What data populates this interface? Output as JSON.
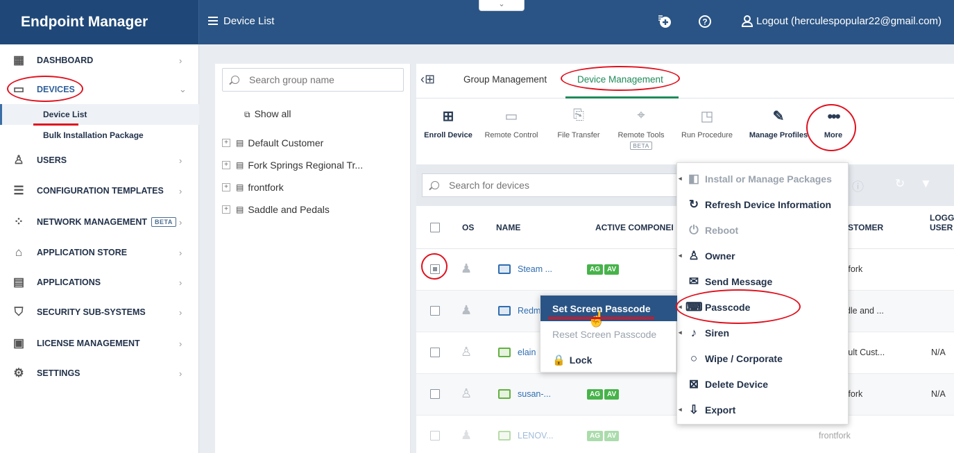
{
  "header": {
    "brand": "Endpoint Manager",
    "page_title": "Device List",
    "logout_label": "Logout (herculespopular22@gmail.com)",
    "collapse_glyph": "⌄"
  },
  "sidebar": {
    "items": [
      {
        "label": "DASHBOARD",
        "icon": "dashboard-icon"
      },
      {
        "label": "DEVICES",
        "icon": "devices-icon"
      },
      {
        "label": "USERS",
        "icon": "user-icon"
      },
      {
        "label": "CONFIGURATION TEMPLATES",
        "icon": "templates-icon"
      },
      {
        "label": "NETWORK MANAGEMENT",
        "icon": "network-icon",
        "badge": "BETA"
      },
      {
        "label": "APPLICATION STORE",
        "icon": "store-icon"
      },
      {
        "label": "APPLICATIONS",
        "icon": "applications-icon"
      },
      {
        "label": "SECURITY SUB-SYSTEMS",
        "icon": "shield-icon"
      },
      {
        "label": "LICENSE MANAGEMENT",
        "icon": "license-icon"
      },
      {
        "label": "SETTINGS",
        "icon": "gear-icon"
      }
    ],
    "sub_items": [
      {
        "label": "Device List"
      },
      {
        "label": "Bulk Installation Package"
      }
    ]
  },
  "groups": {
    "search_placeholder": "Search group name",
    "show_all": "Show all",
    "items": [
      "Default Customer",
      "Fork Springs Regional Tr...",
      "frontfork",
      "Saddle and Pedals"
    ]
  },
  "tabs": {
    "group_management": "Group Management",
    "device_management": "Device Management"
  },
  "toolbar": {
    "enroll": "Enroll Device",
    "remote_control": "Remote Control",
    "file_transfer": "File Transfer",
    "remote_tools": "Remote Tools",
    "beta": "BETA",
    "run_procedure": "Run Procedure",
    "manage_profiles": "Manage Profiles",
    "more": "More"
  },
  "device_search": {
    "placeholder": "Search for devices"
  },
  "table": {
    "headers": {
      "os": "OS",
      "name": "NAME",
      "active_components": "ACTIVE COMPONEI",
      "customer": "STOMER",
      "logged_user_1": "LOGGED",
      "logged_user_2": "USER"
    },
    "rows": [
      {
        "name": "Steam ...",
        "badges": [
          "AG",
          "AV"
        ],
        "customer": "ntfork",
        "logged": ""
      },
      {
        "name": "Redm",
        "badges": [],
        "customer": "ddle and ...",
        "logged": ""
      },
      {
        "name": "elain",
        "badges": [],
        "customer": "fault Cust...",
        "logged": "N/A"
      },
      {
        "name": "susan-...",
        "badges": [
          "AG",
          "AV"
        ],
        "customer": "ntfork",
        "logged": "N/A"
      },
      {
        "name": "LENOV...",
        "badges": [
          "AG",
          "AV"
        ],
        "customer": "frontfork",
        "logged": ""
      }
    ]
  },
  "more_menu": {
    "items": [
      {
        "label": "Install or Manage Packages",
        "disabled": true,
        "submenu": true
      },
      {
        "label": "Refresh Device Information",
        "disabled": false,
        "submenu": false
      },
      {
        "label": "Reboot",
        "disabled": true,
        "submenu": false
      },
      {
        "label": "Owner",
        "disabled": false,
        "submenu": true
      },
      {
        "label": "Send Message",
        "disabled": false,
        "submenu": false
      },
      {
        "label": "Passcode",
        "disabled": false,
        "submenu": true
      },
      {
        "label": "Siren",
        "disabled": false,
        "submenu": true
      },
      {
        "label": "Wipe / Corporate",
        "disabled": false,
        "submenu": false
      },
      {
        "label": "Delete Device",
        "disabled": false,
        "submenu": false
      },
      {
        "label": "Export",
        "disabled": false,
        "submenu": true
      }
    ]
  },
  "passcode_menu": {
    "items": [
      {
        "label": "Set Screen Passcode"
      },
      {
        "label": "Reset Screen Passcode"
      },
      {
        "label": "Lock"
      }
    ]
  },
  "colors": {
    "header": "#2a5485",
    "brand": "#1f4878",
    "accent_green": "#1f8a5a",
    "annotation_red": "#e0111e"
  }
}
